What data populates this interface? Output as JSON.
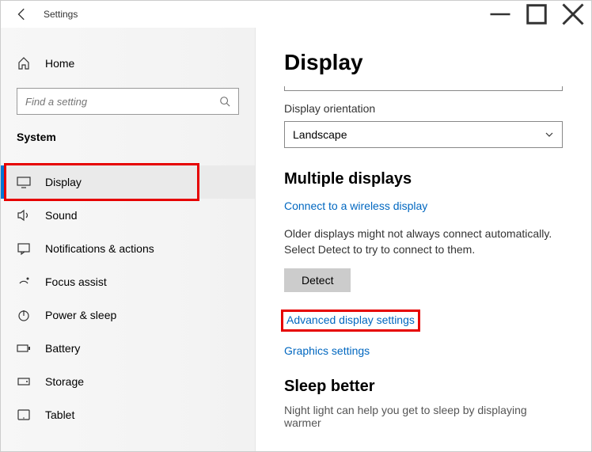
{
  "window": {
    "title": "Settings"
  },
  "sidebar": {
    "home_label": "Home",
    "search_placeholder": "Find a setting",
    "category_label": "System",
    "items": [
      {
        "label": "Display"
      },
      {
        "label": "Sound"
      },
      {
        "label": "Notifications & actions"
      },
      {
        "label": "Focus assist"
      },
      {
        "label": "Power & sleep"
      },
      {
        "label": "Battery"
      },
      {
        "label": "Storage"
      },
      {
        "label": "Tablet"
      }
    ]
  },
  "main": {
    "title": "Display",
    "orientation_label": "Display orientation",
    "orientation_value": "Landscape",
    "multiple_title": "Multiple displays",
    "wireless_link": "Connect to a wireless display",
    "detect_help": "Older displays might not always connect automatically. Select Detect to try to connect to them.",
    "detect_btn": "Detect",
    "advanced_link": "Advanced display settings",
    "graphics_link": "Graphics settings",
    "sleep_title": "Sleep better",
    "sleep_text": "Night light can help you get to sleep by displaying warmer"
  }
}
